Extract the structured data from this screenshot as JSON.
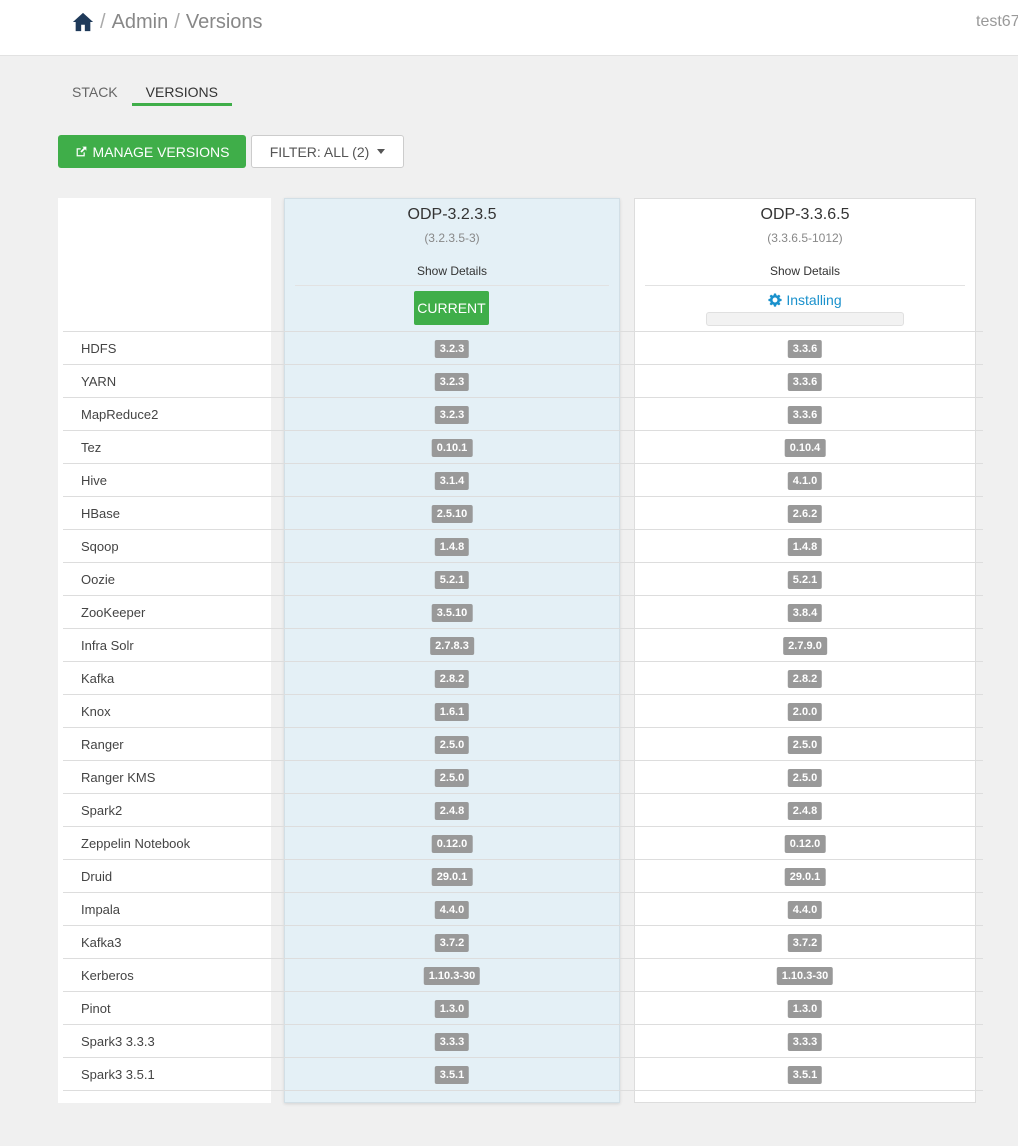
{
  "breadcrumb": {
    "home_icon": "home-icon",
    "items": [
      "Admin",
      "Versions"
    ],
    "separator": "/"
  },
  "user": {
    "name": "test67"
  },
  "tabs": [
    {
      "label": "STACK",
      "active": false
    },
    {
      "label": "VERSIONS",
      "active": true
    }
  ],
  "toolbar": {
    "manage_label": "MANAGE VERSIONS",
    "manage_icon": "external-link-icon",
    "filter_label": "FILTER: ALL (2)"
  },
  "colors": {
    "accent_green": "#3fae49",
    "link_blue": "#1a91cc",
    "current_column_bg": "#e4f0f6",
    "badge_gray": "#999999"
  },
  "versions": [
    {
      "name": "ODP-3.2.3.5",
      "build": "(3.2.3.5-3)",
      "details_label": "Show Details",
      "status_label": "CURRENT",
      "is_current": true
    },
    {
      "name": "ODP-3.3.6.5",
      "build": "(3.3.6.5-1012)",
      "details_label": "Show Details",
      "status_label": "Installing",
      "status_icon": "gear-icon",
      "progress": 0
    }
  ],
  "services": [
    {
      "name": "HDFS",
      "v1": "3.2.3",
      "v2": "3.3.6"
    },
    {
      "name": "YARN",
      "v1": "3.2.3",
      "v2": "3.3.6"
    },
    {
      "name": "MapReduce2",
      "v1": "3.2.3",
      "v2": "3.3.6"
    },
    {
      "name": "Tez",
      "v1": "0.10.1",
      "v2": "0.10.4"
    },
    {
      "name": "Hive",
      "v1": "3.1.4",
      "v2": "4.1.0"
    },
    {
      "name": "HBase",
      "v1": "2.5.10",
      "v2": "2.6.2"
    },
    {
      "name": "Sqoop",
      "v1": "1.4.8",
      "v2": "1.4.8"
    },
    {
      "name": "Oozie",
      "v1": "5.2.1",
      "v2": "5.2.1"
    },
    {
      "name": "ZooKeeper",
      "v1": "3.5.10",
      "v2": "3.8.4"
    },
    {
      "name": "Infra Solr",
      "v1": "2.7.8.3",
      "v2": "2.7.9.0"
    },
    {
      "name": "Kafka",
      "v1": "2.8.2",
      "v2": "2.8.2"
    },
    {
      "name": "Knox",
      "v1": "1.6.1",
      "v2": "2.0.0"
    },
    {
      "name": "Ranger",
      "v1": "2.5.0",
      "v2": "2.5.0"
    },
    {
      "name": "Ranger KMS",
      "v1": "2.5.0",
      "v2": "2.5.0"
    },
    {
      "name": "Spark2",
      "v1": "2.4.8",
      "v2": "2.4.8"
    },
    {
      "name": "Zeppelin Notebook",
      "v1": "0.12.0",
      "v2": "0.12.0"
    },
    {
      "name": "Druid",
      "v1": "29.0.1",
      "v2": "29.0.1"
    },
    {
      "name": "Impala",
      "v1": "4.4.0",
      "v2": "4.4.0"
    },
    {
      "name": "Kafka3",
      "v1": "3.7.2",
      "v2": "3.7.2"
    },
    {
      "name": "Kerberos",
      "v1": "1.10.3-30",
      "v2": "1.10.3-30"
    },
    {
      "name": "Pinot",
      "v1": "1.3.0",
      "v2": "1.3.0"
    },
    {
      "name": "Spark3 3.3.3",
      "v1": "3.3.3",
      "v2": "3.3.3"
    },
    {
      "name": "Spark3 3.5.1",
      "v1": "3.5.1",
      "v2": "3.5.1"
    }
  ]
}
